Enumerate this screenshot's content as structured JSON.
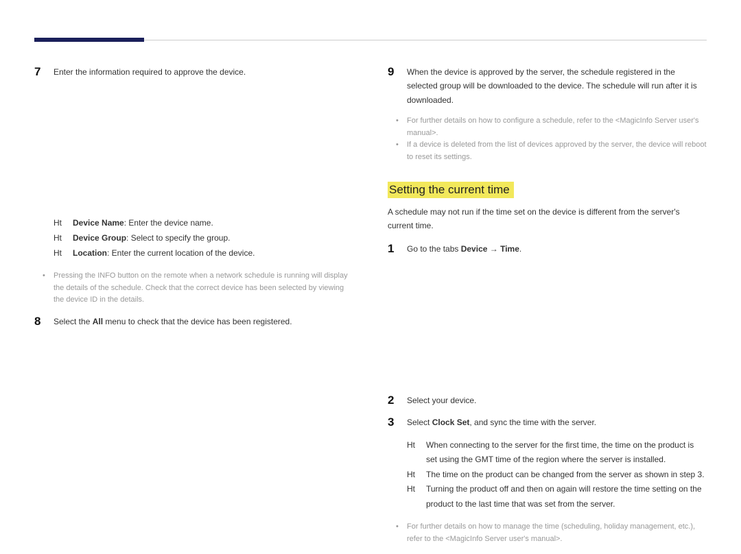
{
  "left": {
    "step7": {
      "num": "7",
      "text": "Enter the information required to approve the device."
    },
    "dash": {
      "a": {
        "mark": "Ht",
        "label": "Device Name",
        "text": ": Enter the device name."
      },
      "b": {
        "mark": "Ht",
        "label": "Device Group",
        "text": ": Select        to specify the group."
      },
      "c": {
        "mark": "Ht",
        "label": "Location",
        "text": ": Enter the current location of the device."
      }
    },
    "note1": "Pressing the INFO button on the remote when a network schedule is running will display the details of the schedule. Check that the correct device has been selected by viewing the device ID in the details.",
    "step8": {
      "num": "8",
      "pre": "Select the ",
      "bold": "All",
      "post": " menu to check that the device has been registered."
    }
  },
  "right": {
    "step9": {
      "num": "9",
      "text": "When the device is approved by the server, the schedule registered in the selected group will be downloaded to the device. The schedule will run after it is downloaded."
    },
    "notesA": {
      "a": "For further details on how to configure a schedule, refer to the <MagicInfo Server user's manual>.",
      "b": "If a device is deleted from the list of devices approved by the server, the device will reboot to reset its settings."
    },
    "sectionTitle": "Setting the current time",
    "lead": "A schedule may not run if the time set on the device is different from the server's current time.",
    "step1": {
      "num": "1",
      "pre": "Go to the tabs ",
      "b1": "Device",
      "arrow": " → ",
      "b2": "Time",
      "post": "."
    },
    "step2": {
      "num": "2",
      "text": "Select your device."
    },
    "step3": {
      "num": "3",
      "pre": "Select ",
      "bold": "Clock Set",
      "post": ", and sync the time with the server."
    },
    "dashB": {
      "a": {
        "mark": "Ht",
        "text": "When connecting to the server for the first time, the time on the product is set using the GMT time of the region where the server is installed."
      },
      "b": {
        "mark": "Ht",
        "text": "The time on the product can be changed from the server as shown in step 3."
      },
      "c": {
        "mark": "Ht",
        "text": "Turning the product off and then on again will restore the time setting on the product to the last time that was set from the server."
      }
    },
    "noteB": "For further details on how to manage the time (scheduling, holiday management, etc.), refer to the <MagicInfo Server user's manual>."
  }
}
